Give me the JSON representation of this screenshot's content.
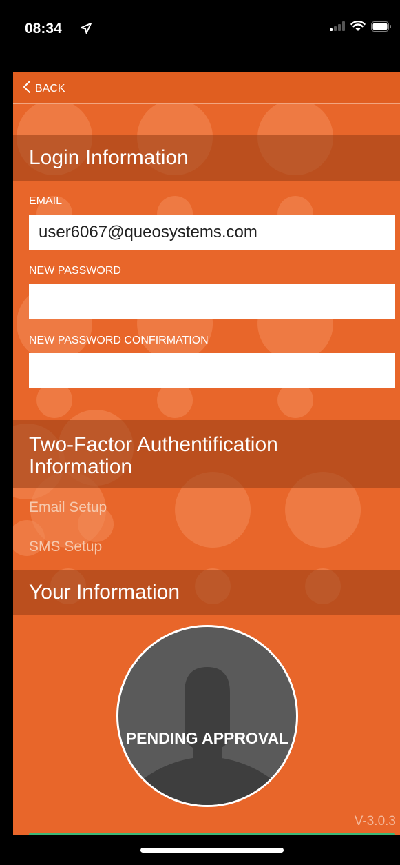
{
  "status_bar": {
    "time": "08:34"
  },
  "nav": {
    "back_label": "BACK"
  },
  "login_section": {
    "title": "Login Information",
    "email_label": "EMAIL",
    "email_value": "user6067@queosystems.com",
    "new_password_label": "NEW PASSWORD",
    "new_password_value": "",
    "confirm_label": "NEW PASSWORD CONFIRMATION",
    "confirm_value": ""
  },
  "two_factor_section": {
    "title_line1": "Two-Factor Authentification",
    "title_line2": "Information",
    "email_setup": "Email Setup",
    "sms_setup": "SMS Setup"
  },
  "your_info_section": {
    "title": "Your Information",
    "avatar_status": "PENDING APPROVAL"
  },
  "footer": {
    "version": "V-3.0.3"
  },
  "colors": {
    "background": "#E8662A",
    "header_band": "#B24F1F",
    "accent_green": "#3cb878"
  },
  "icons": [
    "location-arrow-icon",
    "signal-icon",
    "wifi-icon",
    "battery-icon",
    "chevron-left-icon",
    "person-silhouette-icon"
  ]
}
